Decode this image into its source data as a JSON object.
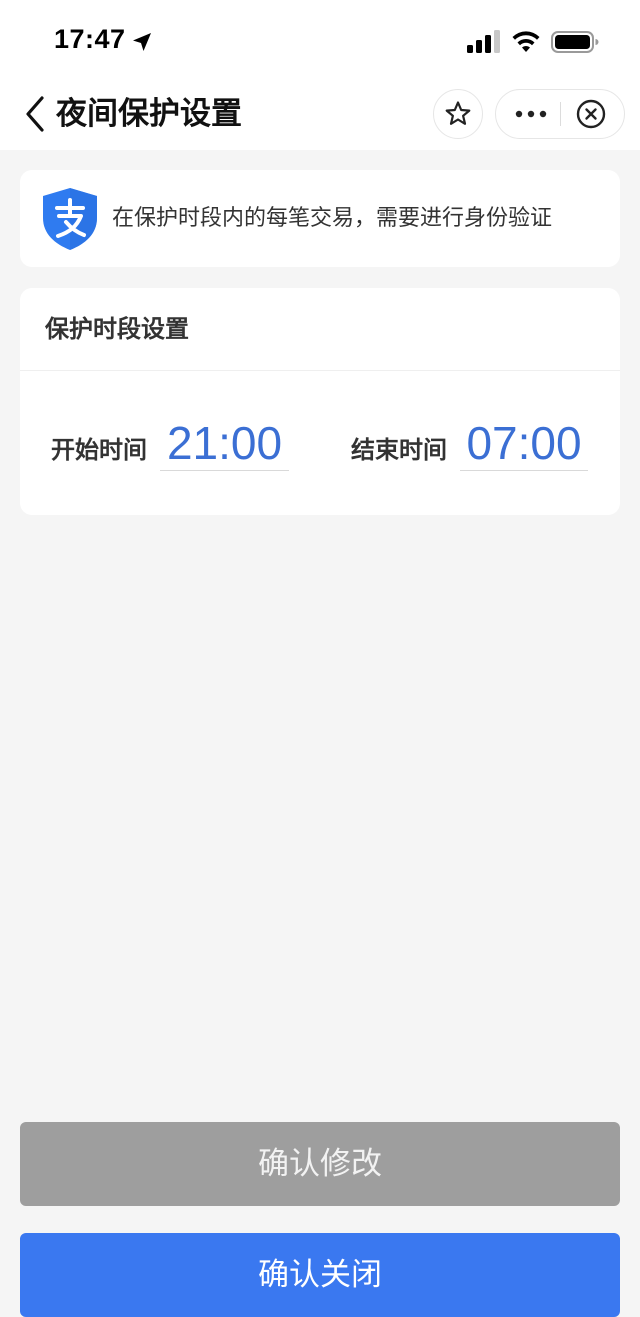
{
  "status_bar": {
    "time": "17:47",
    "icons": [
      "location-arrow-icon",
      "signal-icon",
      "wifi-icon",
      "battery-icon"
    ]
  },
  "nav": {
    "title": "夜间保护设置",
    "icons": [
      "chevron-left-icon",
      "star-icon",
      "more-icon",
      "close-circle-icon"
    ]
  },
  "info_card": {
    "icon": "alipay-shield-icon",
    "text": "在保护时段内的每笔交易，需要进行身份验证"
  },
  "settings_card": {
    "title": "保护时段设置",
    "start_label": "开始时间",
    "start_time": "21:00",
    "end_label": "结束时间",
    "end_time": "07:00"
  },
  "buttons": {
    "confirm_modify": "确认修改",
    "confirm_close": "确认关闭"
  },
  "colors": {
    "accent_blue": "#3a78f0",
    "time_blue": "#3b6fd4",
    "disabled_gray": "#9e9e9e",
    "background": "#f5f5f5"
  }
}
